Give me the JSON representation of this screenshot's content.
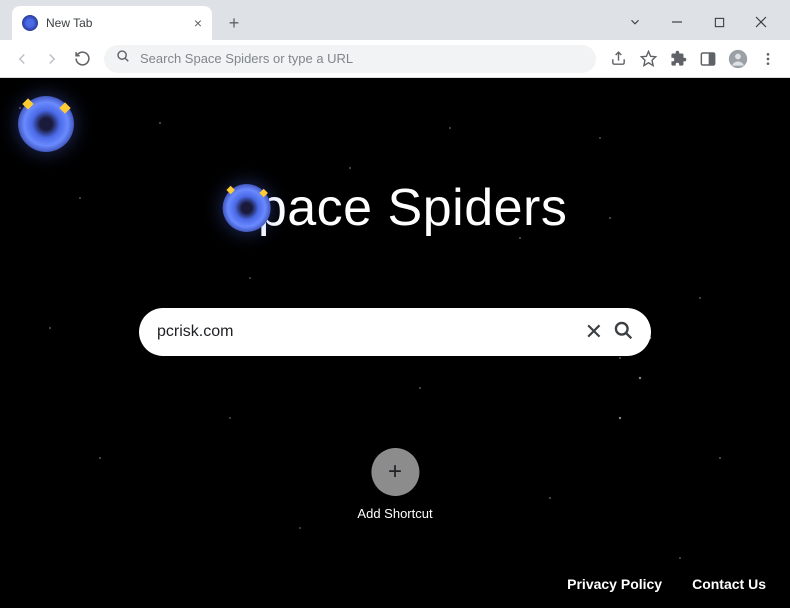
{
  "window": {
    "tab_title": "New Tab"
  },
  "omnibox": {
    "placeholder": "Search Space Spiders or type a URL"
  },
  "page": {
    "brand": "Space Spiders",
    "search_value": "pcrisk.com",
    "shortcut_label": "Add Shortcut"
  },
  "footer": {
    "privacy": "Privacy Policy",
    "contact": "Contact Us"
  }
}
